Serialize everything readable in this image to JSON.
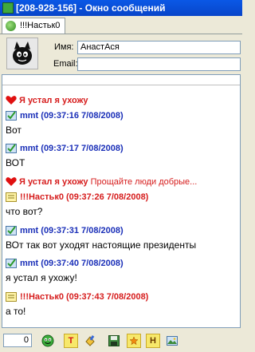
{
  "window": {
    "title": "[208-928-156] - Окно сообщений"
  },
  "tab": {
    "label": "!!!Настьк0"
  },
  "contact": {
    "name_label": "Имя:",
    "name_value": "АнастАся",
    "email_label": "Email:",
    "email_value": ""
  },
  "messages": [
    {
      "kind": "status",
      "header": "Я устал я ухожу",
      "note": "",
      "text": ""
    },
    {
      "kind": "mine",
      "header": "mmt (09:37:16 7/08/2008)",
      "text": "Вот"
    },
    {
      "kind": "mine",
      "header": "mmt (09:37:17 7/08/2008)",
      "text": "ВОТ"
    },
    {
      "kind": "status",
      "header": "Я устал я ухожу",
      "note": "Прощайте люди добрые...",
      "text": ""
    },
    {
      "kind": "theirs",
      "header": "!!!Настьк0 (09:37:26 7/08/2008)",
      "text": "что вот?"
    },
    {
      "kind": "mine",
      "header": "mmt (09:37:31 7/08/2008)",
      "text": "ВОт так вот уходят настоящие президенты"
    },
    {
      "kind": "mine",
      "header": "mmt (09:37:40 7/08/2008)",
      "text": "я устал я ухожу!"
    },
    {
      "kind": "theirs",
      "header": "!!!Настьк0 (09:37:43 7/08/2008)",
      "text": "а то!"
    }
  ],
  "toolbar": {
    "char_count": "0",
    "buttons": [
      "smiley-icon",
      "text-color-icon",
      "paint-icon",
      "save-icon",
      "star-icon",
      "history-icon",
      "image-icon"
    ],
    "text_button_label": "T",
    "history_button_label": "H"
  },
  "colors": {
    "mine": "#1a2fb8",
    "theirs": "#d61c1c",
    "status": "#d61c1c",
    "title_bar": "#0a58e6"
  }
}
